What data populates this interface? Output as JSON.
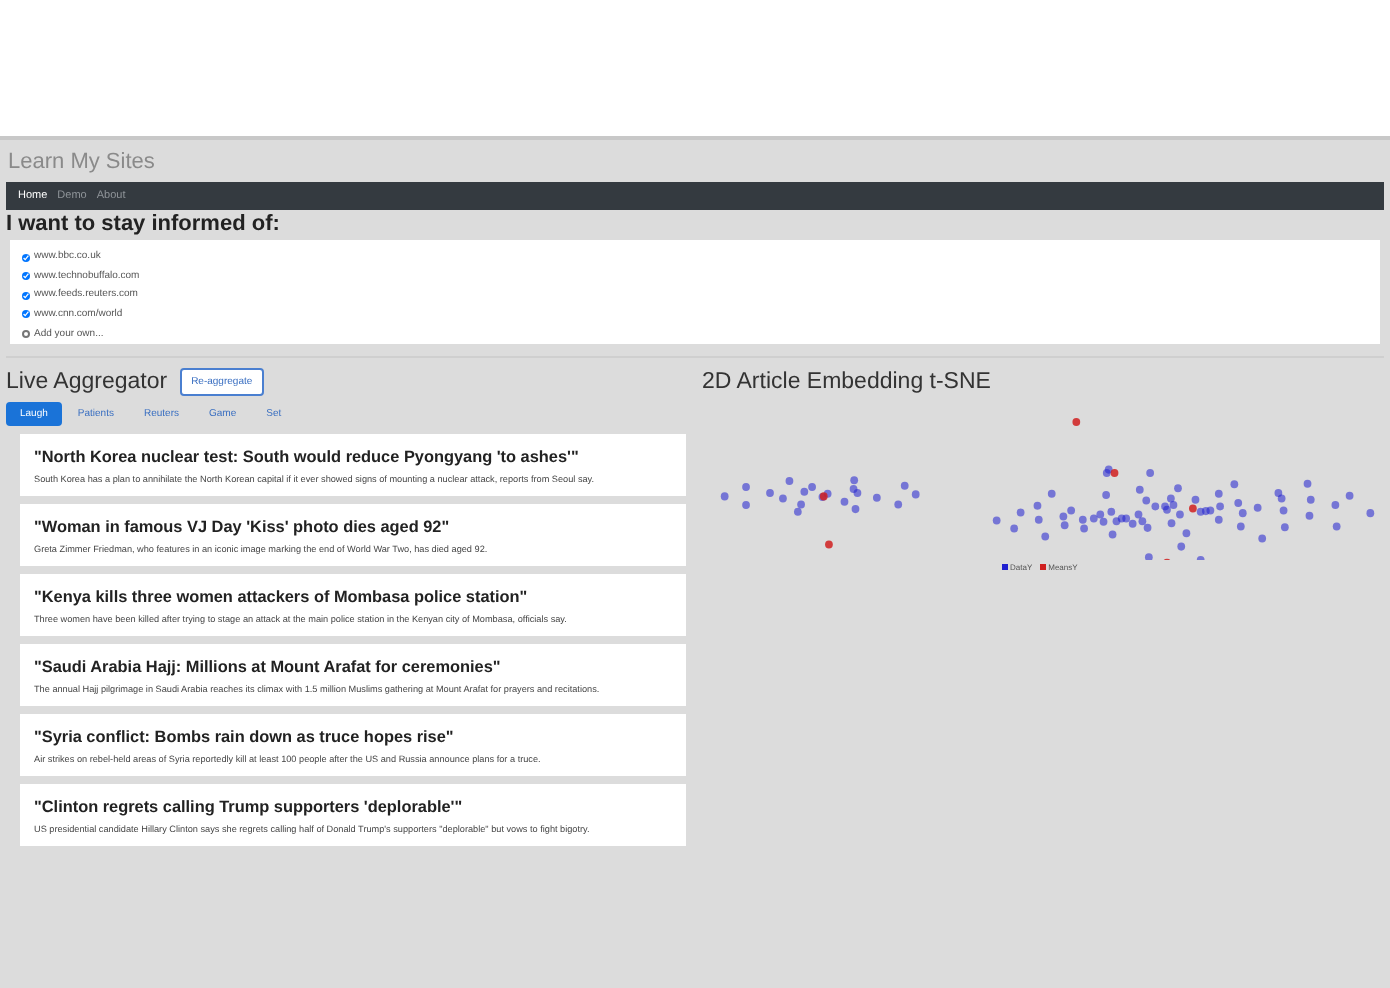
{
  "app_title": "Learn My Sites",
  "nav": [
    {
      "label": "Home",
      "selected": true
    },
    {
      "label": "Demo",
      "selected": false
    },
    {
      "label": "About",
      "selected": false
    }
  ],
  "sites_heading": "I want to stay informed of:",
  "sites": [
    {
      "label": "www.bbc.co.uk",
      "checked": true
    },
    {
      "label": "www.technobuffalo.com",
      "checked": true
    },
    {
      "label": "www.feeds.reuters.com",
      "checked": true
    },
    {
      "label": "www.cnn.com/world",
      "checked": true
    }
  ],
  "add_site": {
    "checked": false,
    "placeholder": "Add your own..."
  },
  "aggregator": {
    "title": "Live Aggregator",
    "button": "Re-aggregate",
    "tabs": [
      {
        "label": "Laugh",
        "selected": true
      },
      {
        "label": "Patients",
        "selected": false
      },
      {
        "label": "Reuters",
        "selected": false
      },
      {
        "label": "Game",
        "selected": false
      },
      {
        "label": "Set",
        "selected": false
      }
    ],
    "articles": [
      {
        "title": "\"North Korea nuclear test: South would reduce Pyongyang 'to ashes'\"",
        "summary": "South Korea has a plan to annihilate the North Korean capital if it ever showed signs of mounting a nuclear attack, reports from Seoul say."
      },
      {
        "title": "\"Woman in famous VJ Day 'Kiss' photo dies aged 92\"",
        "summary": "Greta Zimmer Friedman, who features in an iconic image marking the end of World War Two, has died aged 92."
      },
      {
        "title": "\"Kenya kills three women attackers of Mombasa police station\"",
        "summary": "Three women have been killed after trying to stage an attack at the main police station in the Kenyan city of Mombasa, officials say."
      },
      {
        "title": "\"Saudi Arabia Hajj: Millions at Mount Arafat for ceremonies\"",
        "summary": "The annual Hajj pilgrimage in Saudi Arabia reaches its climax with 1.5 million Muslims gathering at Mount Arafat for prayers and recitations."
      },
      {
        "title": "\"Syria conflict: Bombs rain down as truce hopes rise\"",
        "summary": "Air strikes on rebel-held areas of Syria reportedly kill at least 100 people after the US and Russia announce plans for a truce."
      },
      {
        "title": "\"Clinton regrets calling Trump supporters 'deplorable'\"",
        "summary": "US presidential candidate Hillary Clinton says she regrets calling half of Donald Trump's supporters \"deplorable\" but vows to fight bigotry."
      }
    ]
  },
  "embedding": {
    "title": "2D Article Embedding t-SNE",
    "legend": [
      {
        "label": "DataY",
        "color": "#2020d0"
      },
      {
        "label": "MeansY",
        "color": "#d02020"
      }
    ]
  }
}
